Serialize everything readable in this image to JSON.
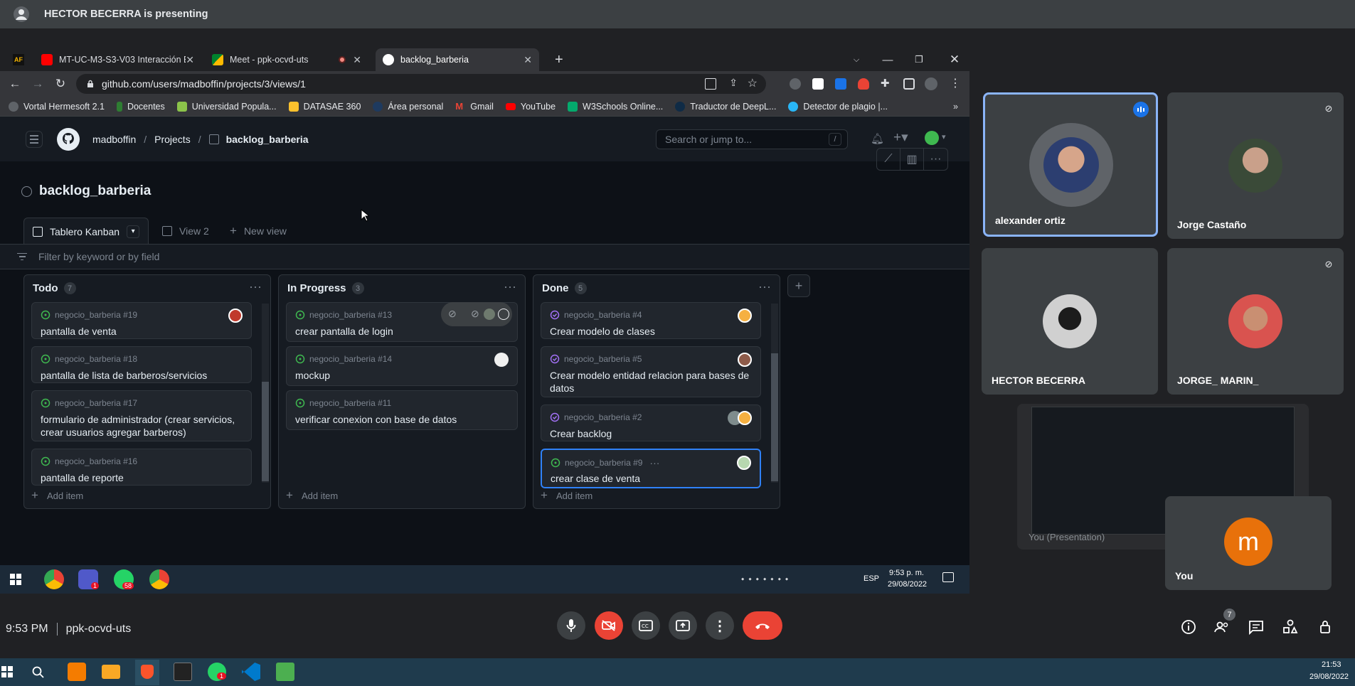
{
  "meet": {
    "presenting_banner": "HECTOR BECERRA is presenting",
    "time": "9:53 PM",
    "meeting_code": "ppk-ocvd-uts",
    "participants_count": "7",
    "tiles": [
      {
        "name": "alexander ortiz",
        "speaking": true
      },
      {
        "name": "Jorge Castaño",
        "muted": true
      },
      {
        "name": "HECTOR BECERRA"
      },
      {
        "name": "JORGE_ MARIN_",
        "muted": true
      }
    ],
    "presentation_label": "You (Presentation)",
    "self_tile": {
      "name": "You",
      "initial": "m",
      "color": "#e8710a"
    }
  },
  "browser": {
    "tabs": [
      {
        "label": "MT-UC-M3-S3-V03 Interacción E",
        "icon_color": "#ff0000"
      },
      {
        "label": "Meet - ppk-ocvd-uts",
        "icon_color": "#00832d"
      },
      {
        "label": "backlog_barberia",
        "icon_color": "#ffffff"
      }
    ],
    "url": "github.com/users/madboffin/projects/3/views/1",
    "bookmarks": [
      "Vortal Hermesoft 2.1",
      "Docentes",
      "Universidad Popula...",
      "DATASAE 360",
      "Área personal",
      "Gmail",
      "YouTube",
      "W3Schools Online...",
      "Traductor de DeepL...",
      "Detector de plagio |..."
    ]
  },
  "github": {
    "user": "madboffin",
    "projects": "Projects",
    "project": "backlog_barberia",
    "search_placeholder": "Search or jump to...",
    "search_key": "/",
    "project_title": "backlog_barberia",
    "views": [
      "Tablero Kanban",
      "View 2",
      "New view"
    ],
    "filter_placeholder": "Filter by keyword or by field",
    "add_item": "Add item",
    "columns": [
      {
        "name": "Todo",
        "count": "7",
        "cards": [
          {
            "ref": "negocio_barberia #19",
            "title": "pantalla de venta"
          },
          {
            "ref": "negocio_barberia #18",
            "title": "pantalla de lista de barberos/servicios"
          },
          {
            "ref": "negocio_barberia #17",
            "title": "formulario de administrador (crear servicios, crear usuarios agregar barberos)"
          },
          {
            "ref": "negocio_barberia #16",
            "title": "pantalla de reporte"
          }
        ]
      },
      {
        "name": "In Progress",
        "count": "3",
        "cards": [
          {
            "ref": "negocio_barberia #13",
            "title": "crear pantalla de login"
          },
          {
            "ref": "negocio_barberia #14",
            "title": "mockup"
          },
          {
            "ref": "negocio_barberia #11",
            "title": "verificar conexion con base de datos"
          }
        ]
      },
      {
        "name": "Done",
        "count": "5",
        "cards": [
          {
            "ref": "negocio_barberia #4",
            "title": "Crear modelo de clases"
          },
          {
            "ref": "negocio_barberia #5",
            "title": "Crear modelo entidad relacion para bases de datos"
          },
          {
            "ref": "negocio_barberia #2",
            "title": "Crear backlog"
          },
          {
            "ref": "negocio_barberia #9",
            "title": "crear clase de venta"
          }
        ]
      }
    ]
  },
  "shared_taskbar": {
    "lang": "ESP",
    "time": "9:53 p. m.",
    "date": "29/08/2022",
    "teams_badge": "1",
    "whatsapp_badge": "58"
  },
  "taskbar": {
    "time": "21:53",
    "date": "29/08/2022",
    "whatsapp_badge": "1"
  }
}
